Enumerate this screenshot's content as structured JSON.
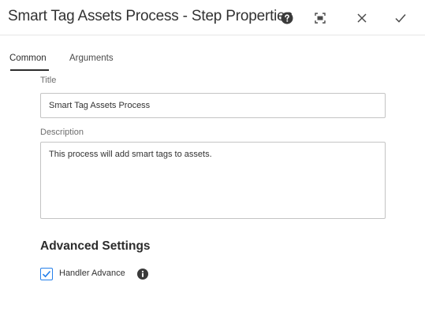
{
  "dialog": {
    "title": "Smart Tag Assets Process - Step Properties",
    "help_icon": "help-circle-icon",
    "fullscreen_icon": "fullscreen-icon",
    "close_icon": "close-icon",
    "done_icon": "checkmark-icon"
  },
  "tabs": [
    {
      "label": "Common",
      "active": true
    },
    {
      "label": "Arguments",
      "active": false
    }
  ],
  "form": {
    "title_label": "Title",
    "title_value": "Smart Tag Assets Process",
    "description_label": "Description",
    "description_value": "This process will add smart tags to assets."
  },
  "advanced": {
    "heading": "Advanced Settings",
    "handler_advance_label": "Handler Advance",
    "handler_advance_checked": true,
    "info_icon": "info-icon"
  },
  "colors": {
    "accent": "#2680eb",
    "text": "#2c2c2c"
  }
}
